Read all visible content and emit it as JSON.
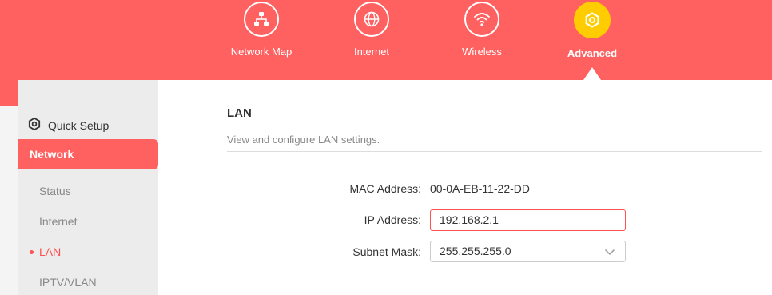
{
  "nav": {
    "items": [
      {
        "label": "Network Map",
        "icon": "network-map-icon"
      },
      {
        "label": "Internet",
        "icon": "globe-icon"
      },
      {
        "label": "Wireless",
        "icon": "wifi-icon"
      },
      {
        "label": "Advanced",
        "icon": "gear-icon"
      }
    ],
    "active": "Advanced"
  },
  "sidebar": {
    "quick_setup": "Quick Setup",
    "section": "Network",
    "items": [
      {
        "label": "Status"
      },
      {
        "label": "Internet"
      },
      {
        "label": "LAN"
      },
      {
        "label": "IPTV/VLAN"
      }
    ],
    "active_item": "LAN"
  },
  "main": {
    "title": "LAN",
    "description": "View and configure LAN settings.",
    "mac_label": "MAC Address:",
    "mac_value": "00-0A-EB-11-22-DD",
    "ip_label": "IP Address:",
    "ip_value": "192.168.2.1",
    "mask_label": "Subnet Mask:",
    "mask_value": "255.255.255.0"
  },
  "colors": {
    "brand": "#ff6060",
    "active_icon": "#ffcc00",
    "active_text": "#ff5050"
  }
}
